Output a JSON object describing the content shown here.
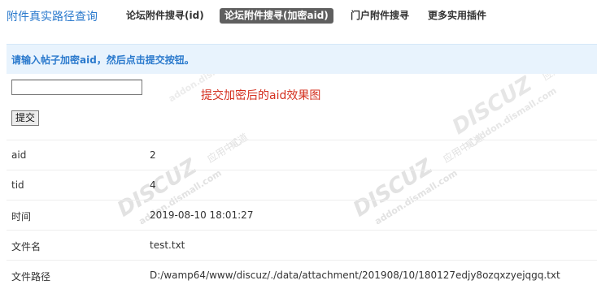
{
  "header": {
    "title": "附件真实路径查询",
    "tabs": [
      {
        "label": "论坛附件搜寻(id)",
        "active": false
      },
      {
        "label": "论坛附件搜寻(加密aid)",
        "active": true
      },
      {
        "label": "门户附件搜寻",
        "active": false
      },
      {
        "label": "更多实用插件",
        "active": false
      }
    ]
  },
  "info": {
    "instruction": "请输入帖子加密aid，然后点击提交按钮。"
  },
  "form": {
    "input_value": "",
    "submit_label": "提交"
  },
  "annotation": "提交加密后的aid效果图",
  "results": [
    {
      "label": "aid",
      "value": "2"
    },
    {
      "label": "tid",
      "value": "4"
    },
    {
      "label": "时间",
      "value": "2019-08-10 18:01:27"
    },
    {
      "label": "文件名",
      "value": "test.txt"
    },
    {
      "label": "文件路径",
      "value": "D:/wamp64/www/discuz/./data/attachment/201908/10/180127edjy8ozqxzyejqgq.txt"
    }
  ],
  "watermark": {
    "brand": "DISCUZ",
    "sub": "应用中心",
    "domain": "addon.dismall.com",
    "mark": "贰道"
  },
  "colors": {
    "title_blue": "#2b7acd",
    "active_tab_bg": "#5f5f5f",
    "infobar_bg": "#e8f3fd",
    "annotation_red": "#d4301f"
  }
}
